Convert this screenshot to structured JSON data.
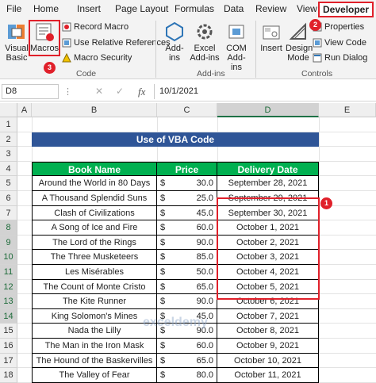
{
  "tabs": [
    "File",
    "Home",
    "Insert",
    "Page Layout",
    "Formulas",
    "Data",
    "Review",
    "View",
    "Developer"
  ],
  "ribbon": {
    "visual_basic": "Visual Basic",
    "macros": "Macros",
    "record_macro": "Record Macro",
    "relative_refs": "Use Relative References",
    "macro_security": "Macro Security",
    "code_group": "Code",
    "addins": "Add-ins",
    "excel_addins": "Excel Add-ins",
    "com_addins": "COM Add-ins",
    "addins_group": "Add-ins",
    "insert": "Insert",
    "design_mode": "Design Mode",
    "properties": "Properties",
    "view_code": "View Code",
    "run_dialog": "Run Dialog",
    "controls_group": "Controls"
  },
  "badges": {
    "developer": "2",
    "macros": "3",
    "range": "1"
  },
  "formula_bar": {
    "name_box": "D8",
    "fx": "fx",
    "value": "10/1/2021"
  },
  "columns": [
    "A",
    "B",
    "C",
    "D",
    "E"
  ],
  "rows": [
    "1",
    "2",
    "3",
    "4",
    "5",
    "6",
    "7",
    "8",
    "9",
    "10",
    "11",
    "12",
    "13",
    "14",
    "15",
    "16",
    "17",
    "18"
  ],
  "sheet": {
    "title": "Use of VBA Code",
    "headers": [
      "Book Name",
      "Price",
      "Delivery Date"
    ],
    "currency": "$",
    "data": [
      [
        "Around the World in 80 Days",
        "30.0",
        "September 28, 2021"
      ],
      [
        "A Thousand Splendid Suns",
        "25.0",
        "September 29, 2021"
      ],
      [
        "Clash of Civilizations",
        "45.0",
        "September 30, 2021"
      ],
      [
        "A Song of Ice and Fire",
        "60.0",
        "October 1, 2021"
      ],
      [
        "The Lord of the Rings",
        "90.0",
        "October 2, 2021"
      ],
      [
        "The Three Musketeers",
        "85.0",
        "October 3, 2021"
      ],
      [
        "Les Misérables",
        "50.0",
        "October 4, 2021"
      ],
      [
        "The Count of Monte Cristo",
        "65.0",
        "October 5, 2021"
      ],
      [
        "The Kite Runner",
        "90.0",
        "October 6, 2021"
      ],
      [
        "King Solomon's Mines",
        "45.0",
        "October 7, 2021"
      ],
      [
        "Nada the Lilly",
        "90.0",
        "October 8, 2021"
      ],
      [
        "The Man in the Iron Mask",
        "60.0",
        "October 9, 2021"
      ],
      [
        "The Hound of the Baskervilles",
        "65.0",
        "October 10, 2021"
      ],
      [
        "The Valley of Fear",
        "80.0",
        "October 11, 2021"
      ]
    ]
  },
  "watermark": "exceldemy",
  "colors": {
    "title_fill": "#2f5597",
    "header_fill": "#00b050",
    "selection_fill": "#c9c9c9",
    "accent_red": "#e0202a",
    "excel_green": "#1e7145"
  }
}
